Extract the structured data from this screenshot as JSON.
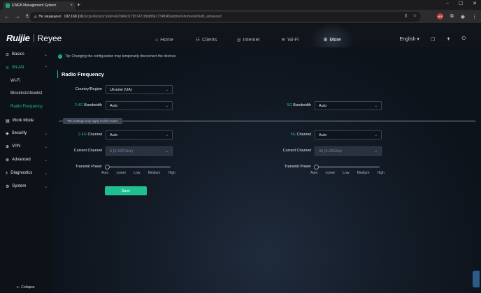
{
  "browser": {
    "tab_title": "EWEB Management System",
    "insecure_label": "Не защищено",
    "url_host": "192.168.110.1",
    "url_path": "/cgi-bin/luci/;stok=a67d4fe01795747c8bd88e1734fb45/admin/ehome/wifi/wifi_advanced"
  },
  "header": {
    "brand": "Ruijie",
    "product": "Reyee",
    "nav": [
      {
        "label": "Home",
        "icon": "home-icon"
      },
      {
        "label": "Clients",
        "icon": "clients-icon"
      },
      {
        "label": "Internet",
        "icon": "globe-icon"
      },
      {
        "label": "Wi-Fi",
        "icon": "wifi-icon"
      },
      {
        "label": "More",
        "icon": "gear-icon"
      }
    ],
    "language": "English"
  },
  "sidebar": {
    "items": [
      {
        "label": "Basics"
      },
      {
        "label": "WLAN"
      },
      {
        "label": "Wi-Fi"
      },
      {
        "label": "Blocklist/Allowlist"
      },
      {
        "label": "Radio Frequency"
      },
      {
        "label": "Work Mode"
      },
      {
        "label": "Security"
      },
      {
        "label": "VPN"
      },
      {
        "label": "Advanced"
      },
      {
        "label": "Diagnostics"
      },
      {
        "label": "System"
      }
    ],
    "collapse_label": "Collapse"
  },
  "main": {
    "tip": "Tip: Changing the configuration may temporarily disconnect the devices.",
    "section_title": "Radio Frequency",
    "country_label": "Country/Region",
    "country_value": "Ukraine (UA)",
    "band24": "2.4G",
    "band5": "5G",
    "bandwidth_suffix": " Bandwidth",
    "channel_suffix": " Channel",
    "bw24_value": "Auto",
    "bw5_value": "Auto",
    "divider_note": "The settings only apply to this router.",
    "ch24_value": "Auto",
    "ch5_value": "Auto",
    "current_channel_label": "Current Channel",
    "current24_value": "6 (2.437GHz)",
    "current5_value": "44 (5.22GHz)",
    "transmit_power_label": "Transmit Power",
    "power_levels": [
      "Auto",
      "Lower",
      "Low",
      "Medium",
      "High"
    ],
    "power24_level": 0,
    "power5_level": 0,
    "save_label": "Save"
  },
  "colors": {
    "accent": "#1fbf8f",
    "background": "#0b0f16"
  }
}
